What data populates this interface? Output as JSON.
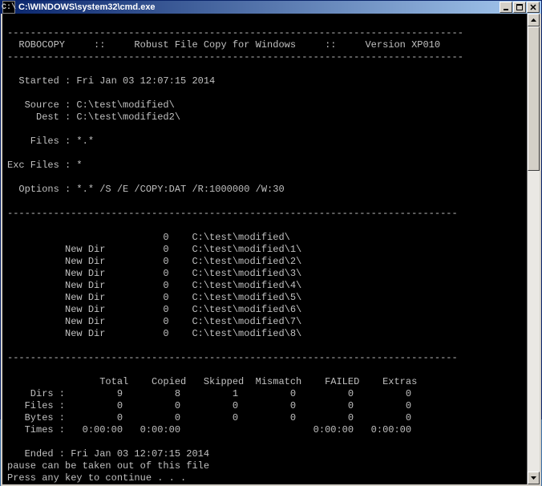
{
  "window": {
    "icon_text": "C:\\",
    "title": "C:\\WINDOWS\\system32\\cmd.exe"
  },
  "header": {
    "sep": "-------------------------------------------------------------------------------",
    "app": "  ROBOCOPY     ::     Robust File Copy for Windows     ::     Version XP010"
  },
  "info": {
    "started": "  Started : Fri Jan 03 12:07:15 2014",
    "source": "   Source : C:\\test\\modified\\",
    "dest": "     Dest : C:\\test\\modified2\\",
    "files": "    Files : *.*",
    "exc": "Exc Files : *",
    "options": "  Options : *.* /S /E /COPY:DAT /R:1000000 /W:30"
  },
  "sep2": "------------------------------------------------------------------------------",
  "dirs": [
    "                           0    C:\\test\\modified\\",
    "          New Dir          0    C:\\test\\modified\\1\\",
    "          New Dir          0    C:\\test\\modified\\2\\",
    "          New Dir          0    C:\\test\\modified\\3\\",
    "          New Dir          0    C:\\test\\modified\\4\\",
    "          New Dir          0    C:\\test\\modified\\5\\",
    "          New Dir          0    C:\\test\\modified\\6\\",
    "          New Dir          0    C:\\test\\modified\\7\\",
    "          New Dir          0    C:\\test\\modified\\8\\"
  ],
  "sep3": "------------------------------------------------------------------------------",
  "summary": {
    "header": "                Total    Copied   Skipped  Mismatch    FAILED    Extras",
    "dirs": "    Dirs :         9         8         1         0         0         0",
    "files": "   Files :         0         0         0         0         0         0",
    "bytes": "   Bytes :         0         0         0         0         0         0",
    "times": "   Times :   0:00:00   0:00:00                       0:00:00   0:00:00"
  },
  "footer": {
    "ended": "   Ended : Fri Jan 03 12:07:15 2014",
    "pause": "pause can be taken out of this file",
    "prompt": "Press any key to continue . . ."
  }
}
